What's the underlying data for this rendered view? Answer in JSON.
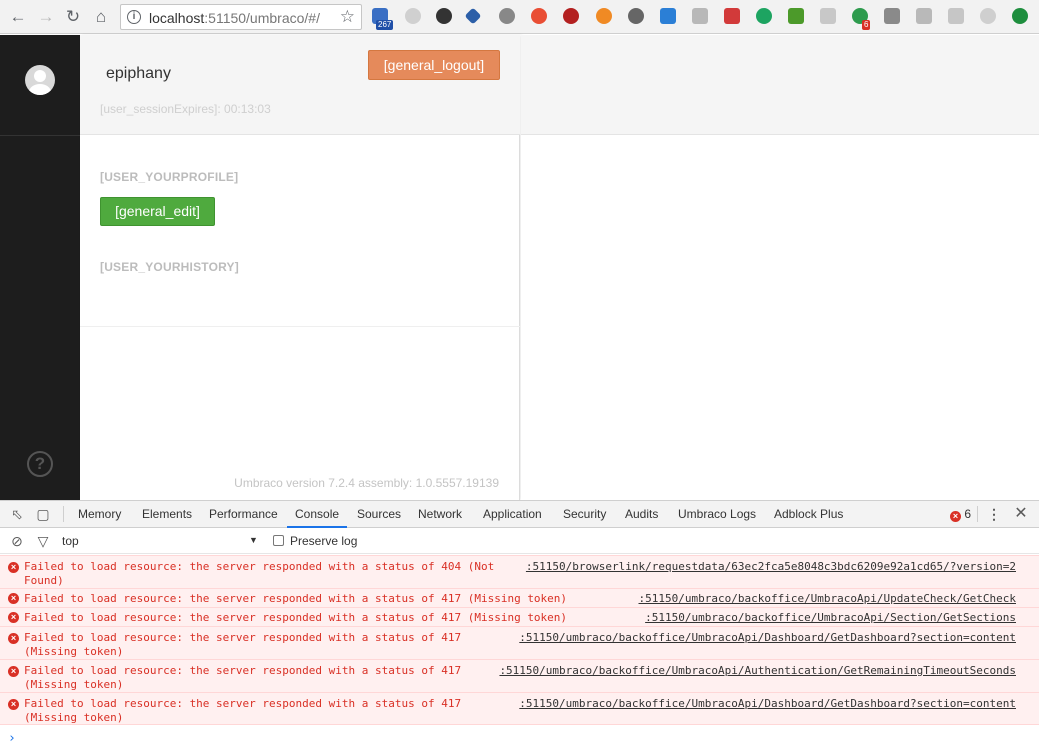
{
  "browser": {
    "url_host": "localhost",
    "url_path": ":51150/umbraco/#/",
    "extension_badges": {
      "mail": "267",
      "counter": "6"
    }
  },
  "user": {
    "name": "epiphany",
    "session_label": "[user_sessionExpires]: 00:13:03",
    "logout_label": "[general_logout]"
  },
  "profile": {
    "section_title": "[USER_YOURPROFILE]",
    "edit_label": "[general_edit]",
    "history_title": "[USER_YOURHISTORY]"
  },
  "footer": {
    "version": "Umbraco version 7.2.4 assembly: 1.0.5557.19139"
  },
  "devtools": {
    "tabs": [
      "Memory",
      "Elements",
      "Performance",
      "Console",
      "Sources",
      "Network",
      "Application",
      "Security",
      "Audits",
      "Umbraco Logs",
      "Adblock Plus"
    ],
    "active_tab": "Console",
    "error_count": "6",
    "context": "top",
    "preserve_log_label": "Preserve log",
    "logs": [
      {
        "msg": "Failed to load resource: the server responded with a status of 404 (Not\nFound)",
        "src": ":51150/browserlink/requestdata/63ec2fca5e8048c3bdc6209e92a1cd65/?version=2"
      },
      {
        "msg": "Failed to load resource: the server responded with a status of 417 (Missing token)",
        "src": ":51150/umbraco/backoffice/UmbracoApi/UpdateCheck/GetCheck"
      },
      {
        "msg": "Failed to load resource: the server responded with a status of 417 (Missing token)",
        "src": ":51150/umbraco/backoffice/UmbracoApi/Section/GetSections"
      },
      {
        "msg": "Failed to load resource: the server responded with a status of 417\n(Missing token)",
        "src": ":51150/umbraco/backoffice/UmbracoApi/Dashboard/GetDashboard?section=content"
      },
      {
        "msg": "Failed to load resource: the server responded with a status of 417\n(Missing token)",
        "src": ":51150/umbraco/backoffice/UmbracoApi/Authentication/GetRemainingTimeoutSeconds"
      },
      {
        "msg": "Failed to load resource: the server responded with a status of 417\n(Missing token)",
        "src": ":51150/umbraco/backoffice/UmbracoApi/Dashboard/GetDashboard?section=content"
      }
    ]
  },
  "colors": {
    "logout": "#e58a5b",
    "edit": "#4faa3e",
    "rail": "#1d1d1d",
    "error": "#d93025"
  },
  "icons": [
    "back-icon",
    "forward-icon",
    "reload-icon",
    "home-icon",
    "info-icon",
    "bookmark-star-icon",
    "user-avatar-icon",
    "help-icon",
    "inspect-icon",
    "device-icon",
    "clear-console-icon",
    "filter-icon",
    "more-icon",
    "close-icon",
    "error-icon"
  ]
}
